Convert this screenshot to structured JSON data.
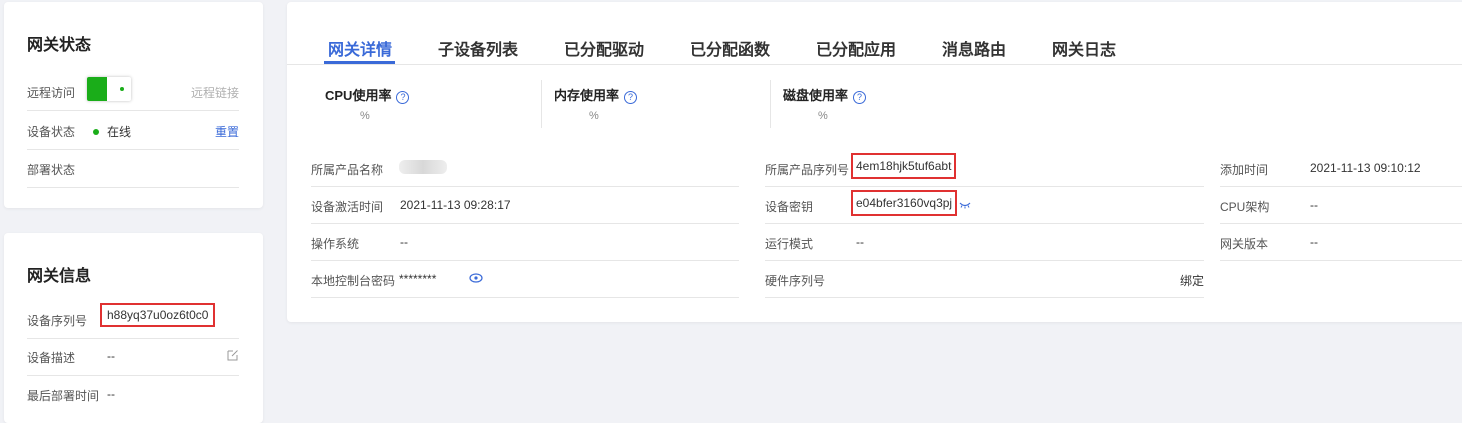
{
  "status_card": {
    "title": "网关状态",
    "remote_access": {
      "label": "远程访问",
      "link": "远程链接",
      "toggle_on": true
    },
    "device_status": {
      "label": "设备状态",
      "value": "在线",
      "action": "重置",
      "color": "#1aad19"
    },
    "deploy_status": {
      "label": "部署状态",
      "value": ""
    }
  },
  "info_card": {
    "title": "网关信息",
    "serial": {
      "label": "设备序列号",
      "value": "h88yq37u0oz6t0c0"
    },
    "description": {
      "label": "设备描述",
      "value": "--"
    },
    "last_deploy": {
      "label": "最后部署时间",
      "value": "--"
    }
  },
  "tabs": [
    {
      "label": "网关详情",
      "active": true
    },
    {
      "label": "子设备列表"
    },
    {
      "label": "已分配驱动"
    },
    {
      "label": "已分配函数"
    },
    {
      "label": "已分配应用"
    },
    {
      "label": "消息路由"
    },
    {
      "label": "网关日志"
    }
  ],
  "metrics": [
    {
      "label": "CPU使用率",
      "unit": "%"
    },
    {
      "label": "内存使用率",
      "unit": "%"
    },
    {
      "label": "磁盘使用率",
      "unit": "%"
    }
  ],
  "details": {
    "col1": [
      {
        "label": "所属产品名称",
        "value": ""
      },
      {
        "label": "设备激活时间",
        "value": "2021-11-13 09:28:17"
      },
      {
        "label": "操作系统",
        "value": "--"
      },
      {
        "label": "本地控制台密码",
        "value": "********"
      }
    ],
    "col2": [
      {
        "label": "所属产品序列号",
        "value": "4em18hjk5tuf6abt"
      },
      {
        "label": "设备密钥",
        "value": "e04bfer3160vq3pj"
      },
      {
        "label": "运行模式",
        "value": "--"
      },
      {
        "label": "硬件序列号",
        "value": "",
        "action": "绑定"
      }
    ],
    "col3": [
      {
        "label": "添加时间",
        "value": "2021-11-13 09:10:12"
      },
      {
        "label": "CPU架构",
        "value": "--"
      },
      {
        "label": "网关版本",
        "value": "--"
      }
    ]
  },
  "colors": {
    "accent": "#3a6ad8",
    "online": "#1aad19",
    "highlight_border": "#e03131"
  }
}
